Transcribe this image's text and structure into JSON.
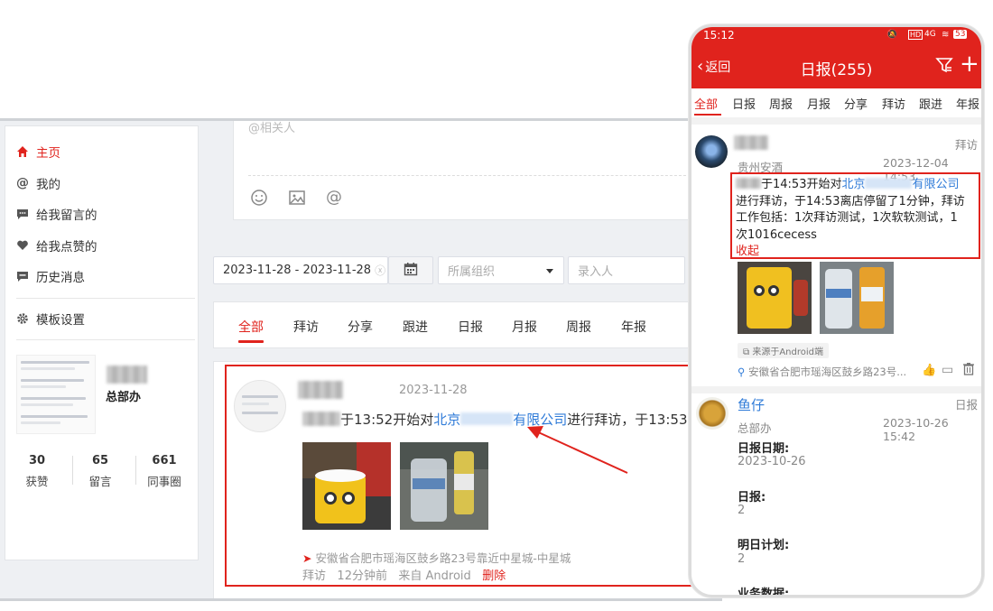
{
  "desktop": {
    "sidebar": {
      "nav": [
        {
          "label": "主页",
          "icon": "home-icon",
          "active": true
        },
        {
          "label": "我的",
          "icon": "at-icon",
          "active": false
        },
        {
          "label": "给我留言的",
          "icon": "comment-icon",
          "active": false
        },
        {
          "label": "给我点赞的",
          "icon": "heart-icon",
          "active": false
        },
        {
          "label": "历史消息",
          "icon": "message-icon",
          "active": false
        }
      ],
      "settings_label": "模板设置",
      "dept": "总部办",
      "stats": [
        {
          "value": "30",
          "label": "获赞"
        },
        {
          "value": "65",
          "label": "留言"
        },
        {
          "value": "661",
          "label": "同事圈"
        }
      ]
    },
    "editor": {
      "mention_placeholder": "@相关人"
    },
    "filters": {
      "date_range": "2023-11-28 - 2023-11-28",
      "org_placeholder": "所属组织",
      "recorder_placeholder": "录入人"
    },
    "tabs": [
      "全部",
      "拜访",
      "分享",
      "跟进",
      "日报",
      "月报",
      "周报",
      "年报"
    ],
    "post": {
      "date": "2023-11-28",
      "text_prefix": "于13:52开始对",
      "company_a": "北京",
      "company_b": "有限公司",
      "text_suffix": "进行拜访，于13:53",
      "location": "安徽省合肥市瑶海区鼓乡路23号靠近中星城-中星城",
      "type": "拜访",
      "time_ago": "12分钟前",
      "source": "来自 Android",
      "delete": "删除"
    }
  },
  "phone": {
    "status": {
      "time": "15:12",
      "battery": "53",
      "network": "4G"
    },
    "appbar": {
      "back": "返回",
      "title": "日报(255)"
    },
    "tabs": [
      "全部",
      "日报",
      "周报",
      "月报",
      "分享",
      "拜访",
      "跟进",
      "年报"
    ],
    "post1": {
      "dept": "贵州安酒",
      "type": "拜访",
      "datetime": "2023-12-04 14:53",
      "line1_prefix": "于14:53开始对",
      "company_a": "北京",
      "company_b": "有限公司",
      "line2": "进行拜访，于14:53离店停留了1分钟，拜访",
      "line3": "工作包括：1次拜访测试，1次软软测试，1",
      "line4": "次1016cecess",
      "collapse": "收起",
      "source_tag": "来源于Android端",
      "location": "安徽省合肥市瑶海区鼓乡路23号..."
    },
    "post2": {
      "name": "鱼仔",
      "dept": "总部办",
      "type": "日报",
      "datetime": "2023-10-26 15:42",
      "fields": [
        {
          "label": "日报日期:",
          "value": "2023-10-26"
        },
        {
          "label": "日报:",
          "value": "2"
        },
        {
          "label": "明日计划:",
          "value": "2"
        },
        {
          "label": "业务数据:",
          "value": ""
        }
      ]
    }
  },
  "colors": {
    "accent": "#e0231d",
    "link": "#2f7bd8"
  }
}
